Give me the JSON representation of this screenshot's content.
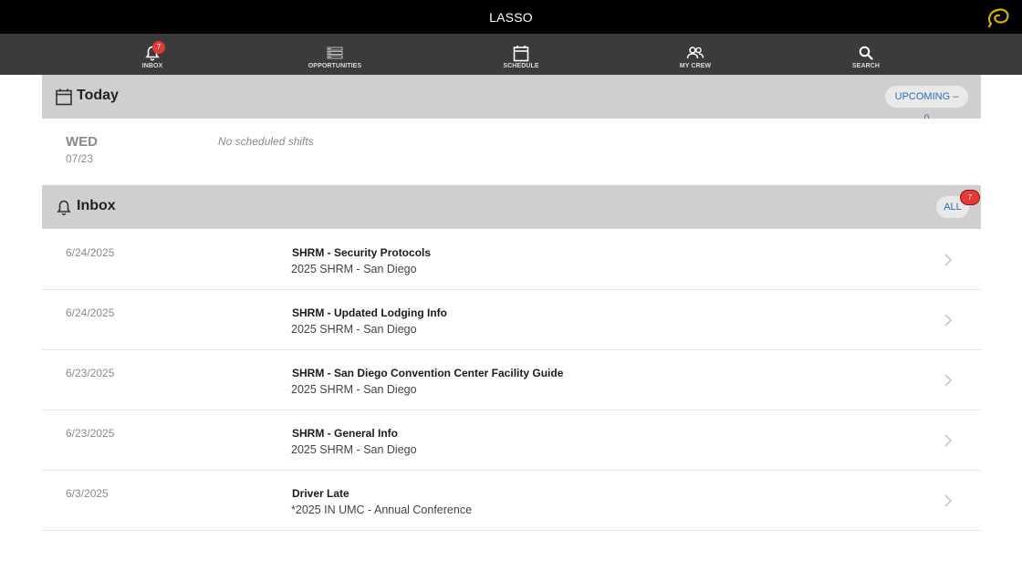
{
  "header": {
    "app_title": "LASSO",
    "logo_icon": "lasso-logo-icon"
  },
  "nav": {
    "items": [
      {
        "label": "INBOX",
        "icon": "bell-icon",
        "badge": "7"
      },
      {
        "label": "OPPORTUNITIES",
        "icon": "list-icon"
      },
      {
        "label": "SCHEDULE",
        "icon": "calendar-icon"
      },
      {
        "label": "MY CREW",
        "icon": "people-icon"
      },
      {
        "label": "SEARCH",
        "icon": "search-icon"
      }
    ]
  },
  "today": {
    "title": "Today",
    "upcoming_label": "UPCOMING – 0",
    "day": "WED",
    "date": "07/23",
    "empty_message": "No scheduled shifts"
  },
  "inbox": {
    "title": "Inbox",
    "all_label": "ALL",
    "badge": "7",
    "messages": [
      {
        "date": "6/24/2025",
        "title": "SHRM - Security Protocols",
        "event": "2025 SHRM - San Diego"
      },
      {
        "date": "6/24/2025",
        "title": "SHRM - Updated Lodging Info",
        "event": "2025 SHRM - San Diego"
      },
      {
        "date": "6/23/2025",
        "title": "SHRM - San Diego Convention Center Facility Guide",
        "event": "2025 SHRM - San Diego"
      },
      {
        "date": "6/23/2025",
        "title": "SHRM - General Info",
        "event": "2025 SHRM - San Diego"
      },
      {
        "date": "6/3/2025",
        "title": "Driver Late",
        "event": "*2025 IN UMC - Annual Conference"
      }
    ]
  },
  "colors": {
    "topbar": "#000000",
    "navbar": "#3b3b3b",
    "section_header": "#cfcfcf",
    "badge": "#e53935",
    "link": "#2a6fb3",
    "logo": "#d4b000"
  }
}
